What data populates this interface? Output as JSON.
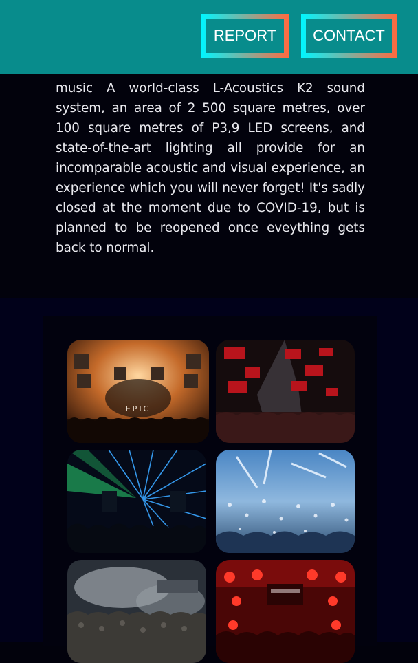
{
  "header": {
    "buttons": [
      {
        "label": "REPORT"
      },
      {
        "label": "CONTACT"
      }
    ],
    "colors": {
      "bar": "#088c8c",
      "gradient_start": "#00f6ff",
      "gradient_end": "#ff6a3f"
    }
  },
  "description": {
    "text": "music A world-class L-Acoustics K2 sound system, an area of 2 500 square metres, over 100 square metres of P3,9 LED screens, and state-of-the-art lighting all provide for an incomparable acoustic and visual experience, an experience which you will never forget! It's sadly closed at the moment due to COVID-19, but is planned to be reopened once eveything gets back to normal."
  },
  "gallery": {
    "photos": [
      {
        "icon": "club-stage-epic-photo",
        "sign": "EPIC"
      },
      {
        "icon": "club-led-cubes-photo"
      },
      {
        "icon": "club-laser-show-photo"
      },
      {
        "icon": "club-confetti-photo"
      },
      {
        "icon": "club-smoke-crowd-photo"
      },
      {
        "icon": "club-red-lights-photo"
      }
    ]
  }
}
